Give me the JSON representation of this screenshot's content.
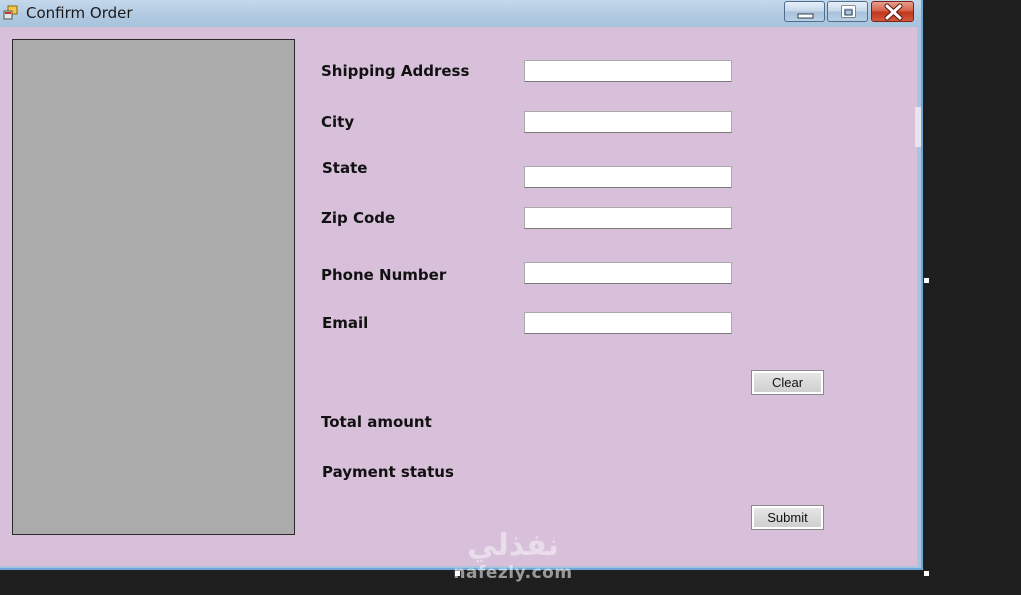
{
  "window": {
    "title": "Confirm Order",
    "icon": "app-form-icon"
  },
  "titlebar_buttons": {
    "minimize_icon": "minimize-icon",
    "maximize_icon": "maximize-icon",
    "close_icon": "close-icon",
    "close_color": "#c7432a"
  },
  "form": {
    "background_color": "#d8c0da",
    "image_panel_color": "#ababab",
    "fields": [
      {
        "label": "Shipping Address",
        "value": ""
      },
      {
        "label": "City",
        "value": ""
      },
      {
        "label": "State",
        "value": ""
      },
      {
        "label": "Zip Code",
        "value": ""
      },
      {
        "label": "Phone Number",
        "value": ""
      },
      {
        "label": "Email",
        "value": ""
      }
    ],
    "clear_label": "Clear",
    "total_label": "Total amount",
    "payment_label": "Payment status",
    "submit_label": "Submit"
  },
  "watermark": {
    "arabic": "نفذلي",
    "latin": "nafezly.com"
  }
}
